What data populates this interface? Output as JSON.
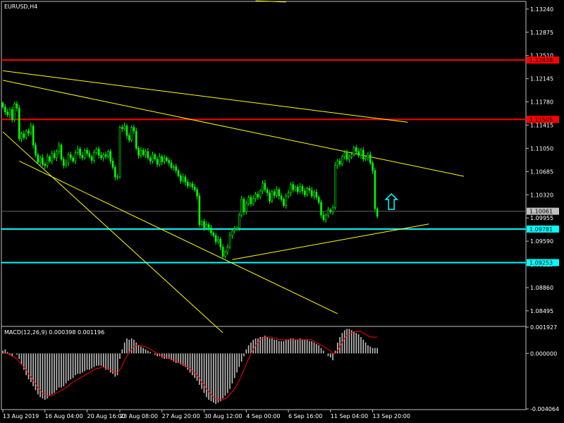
{
  "chart_data": {
    "type": "candlestick",
    "title": "EURUSD,H4",
    "symbol": "EURUSD",
    "timeframe": "H4",
    "background": "#000000",
    "bull_color": "#00ff00",
    "bear_color": "#00ff00",
    "grid": false,
    "price_axis": {
      "ylim": [
        1.0825,
        1.1336
      ],
      "tick_labels": [
        "1.13240",
        "1.12875",
        "1.12510",
        "1.12145",
        "1.11780",
        "1.11415",
        "1.11050",
        "1.10685",
        "1.10320",
        "1.09955",
        "1.09590",
        "1.09225",
        "1.08860",
        "1.08495"
      ],
      "tick_values": [
        1.1324,
        1.12875,
        1.1251,
        1.12145,
        1.1178,
        1.11415,
        1.1105,
        1.10685,
        1.1032,
        1.09955,
        1.0959,
        1.09225,
        1.0886,
        1.08495
      ]
    },
    "time_axis": {
      "labels": [
        "13 Aug 2019",
        "16 Aug 04:00",
        "20 Aug 16:00",
        "23 Aug 08:00",
        "27 Aug 20:00",
        "30 Aug 12:00",
        "4 Sep 00:00",
        "6 Sep 16:00",
        "11 Sep 04:00",
        "13 Sep 20:00"
      ],
      "bar_index": [
        0,
        18,
        36,
        50,
        68,
        86,
        104,
        122,
        140,
        158
      ]
    },
    "current_price": {
      "label": "1.10061",
      "value": 1.10061,
      "color": "#c0c0c0"
    },
    "horizontal_levels": [
      {
        "label": "1.12438",
        "value": 1.12438,
        "color": "#ff0000"
      },
      {
        "label": "1.11505",
        "value": 1.11505,
        "color": "#ff0000"
      },
      {
        "label": "1.09781",
        "value": 1.09781,
        "color": "#00ffff"
      },
      {
        "label": "1.09253",
        "value": 1.09253,
        "color": "#00ffff"
      }
    ],
    "trendlines": [
      {
        "color": "#ffff00",
        "from": {
          "bar": 0,
          "price": 1.1227
        },
        "to": {
          "bar": 173,
          "price": 1.1146
        }
      },
      {
        "color": "#ffff00",
        "from": {
          "bar": 0,
          "price": 1.1212
        },
        "to": {
          "bar": 197,
          "price": 1.1061
        }
      },
      {
        "color": "#ffff00",
        "from": {
          "bar": 0,
          "price": 1.1131
        },
        "to": {
          "bar": 94,
          "price": 1.0815
        }
      },
      {
        "color": "#ffff00",
        "from": {
          "bar": 7,
          "price": 1.1085
        },
        "to": {
          "bar": 143,
          "price": 1.0845
        }
      },
      {
        "color": "#ffff00",
        "from": {
          "bar": 98,
          "price": 1.093
        },
        "to": {
          "bar": 182,
          "price": 1.0986
        }
      },
      {
        "color": "#ffff00",
        "from": {
          "bar": 108,
          "price": 1.1337
        },
        "to": {
          "bar": 121,
          "price": 1.1335
        }
      }
    ],
    "annotation_arrow": {
      "direction": "up",
      "color": "#00ffff",
      "bar": 166,
      "price": 1.103
    },
    "series": [
      {
        "name": "EURUSD",
        "close": [
          1.117,
          1.1162,
          1.1158,
          1.1166,
          1.115,
          1.1175,
          1.1168,
          1.112,
          1.1128,
          1.1122,
          1.1132,
          1.1129,
          1.114,
          1.111,
          1.1095,
          1.1083,
          1.109,
          1.108,
          1.1078,
          1.1092,
          1.1085,
          1.1097,
          1.109,
          1.11,
          1.111,
          1.1088,
          1.1078,
          1.1082,
          1.1095,
          1.109,
          1.1085,
          1.1098,
          1.1104,
          1.1094,
          1.109,
          1.1102,
          1.1097,
          1.1092,
          1.1086,
          1.1098,
          1.1104,
          1.1094,
          1.109,
          1.1095,
          1.1092,
          1.11,
          1.1085,
          1.1075,
          1.106,
          1.106,
          1.1138,
          1.1136,
          1.114,
          1.1125,
          1.1118,
          1.1138,
          1.1132,
          1.1105,
          1.1094,
          1.1102,
          1.1095,
          1.11,
          1.109,
          1.1085,
          1.1095,
          1.1088,
          1.108,
          1.1092,
          1.1084,
          1.109,
          1.1086,
          1.1082,
          1.1075,
          1.1076,
          1.107,
          1.1062,
          1.1054,
          1.106,
          1.1052,
          1.1046,
          1.1049,
          1.1044,
          1.104,
          1.103,
          1.0985,
          1.099,
          1.098,
          1.0985,
          1.098,
          1.0972,
          1.0968,
          1.0958,
          1.0962,
          1.095,
          1.0935,
          1.0942,
          1.095,
          1.0968,
          1.0975,
          1.0978,
          1.098,
          1.1,
          1.1025,
          1.1005,
          1.1018,
          1.1028,
          1.1018,
          1.1026,
          1.1033,
          1.1028,
          1.1038,
          1.105,
          1.104,
          1.1035,
          1.1022,
          1.1037,
          1.1031,
          1.104,
          1.103,
          1.1025,
          1.1015,
          1.103,
          1.1035,
          1.1048,
          1.104,
          1.1044,
          1.1037,
          1.1045,
          1.1038,
          1.1032,
          1.1042,
          1.1039,
          1.103,
          1.1036,
          1.1028,
          1.102,
          1.1,
          1.0993,
          1.1,
          1.1008,
          1.1005,
          1.1012,
          1.1078,
          1.1085,
          1.108,
          1.1092,
          1.1098,
          1.1088,
          1.1092,
          1.1095,
          1.1106,
          1.11,
          1.1094,
          1.1102,
          1.1088,
          1.109,
          1.1095,
          1.1082,
          1.107,
          1.101,
          1.0998
        ]
      }
    ],
    "indicator": {
      "name": "MACD(12,26,9)",
      "label": "MACD(12,26,9) 0.000398 0.001196",
      "macd_value": "0.000398",
      "signal_value": "0.001196",
      "histogram_color": "#c0c0c0",
      "signal_color": "#ff0000",
      "ylim": [
        -0.004064,
        0.001927
      ],
      "tick_labels": [
        "0.001927",
        "0.000000",
        "-0.004064"
      ],
      "tick_values": [
        0.001927,
        0.0,
        -0.004064
      ],
      "histogram": [
        0.0002,
        0.0003,
        0.0001,
        -0.0001,
        -0.0002,
        0.0,
        -0.0001,
        -0.0004,
        -0.0008,
        -0.0012,
        -0.0016,
        -0.0019,
        -0.0021,
        -0.0024,
        -0.0027,
        -0.003,
        -0.0032,
        -0.0033,
        -0.0034,
        -0.0033,
        -0.0031,
        -0.003,
        -0.0029,
        -0.0027,
        -0.0025,
        -0.0025,
        -0.0024,
        -0.0022,
        -0.002,
        -0.0019,
        -0.0018,
        -0.0016,
        -0.0015,
        -0.0015,
        -0.0014,
        -0.0013,
        -0.0012,
        -0.0012,
        -0.0011,
        -0.001,
        -0.0009,
        -0.0009,
        -0.0009,
        -0.001,
        -0.0012,
        -0.0012,
        -0.0014,
        -0.0015,
        -0.0017,
        -0.0016,
        -0.0004,
        0.0003,
        0.0008,
        0.0011,
        0.001,
        0.0011,
        0.001,
        0.0008,
        0.0006,
        0.0005,
        0.0004,
        0.0003,
        0.0002,
        0.0001,
        0.0,
        -0.0001,
        -0.0002,
        -0.0002,
        -0.0003,
        -0.0004,
        -0.0004,
        -0.0004,
        -0.0005,
        -0.0006,
        -0.0007,
        -0.0007,
        -0.0008,
        -0.0009,
        -0.001,
        -0.0012,
        -0.0014,
        -0.0016,
        -0.0018,
        -0.002,
        -0.0023,
        -0.0026,
        -0.0029,
        -0.0032,
        -0.0034,
        -0.0035,
        -0.0036,
        -0.0037,
        -0.0036,
        -0.0035,
        -0.0033,
        -0.0031,
        -0.0029,
        -0.0026,
        -0.0022,
        -0.0018,
        -0.0014,
        -0.001,
        -0.0006,
        -0.0002,
        0.0003,
        0.0006,
        0.0008,
        0.001,
        0.0011,
        0.0011,
        0.0012,
        0.0012,
        0.0013,
        0.0012,
        0.0011,
        0.0011,
        0.001,
        0.001,
        0.0009,
        0.0009,
        0.0009,
        0.001,
        0.001,
        0.0011,
        0.0011,
        0.001,
        0.001,
        0.0011,
        0.001,
        0.001,
        0.001,
        0.0009,
        0.0009,
        0.0008,
        0.0007,
        0.0006,
        0.0004,
        0.0002,
        0.0,
        -0.0002,
        -0.0003,
        -0.0005,
        0.0002,
        0.0008,
        0.0012,
        0.0015,
        0.0017,
        0.0018,
        0.0018,
        0.0017,
        0.0016,
        0.0015,
        0.0014,
        0.0012,
        0.001,
        0.0008,
        0.0006,
        0.0005,
        0.0004,
        0.0004,
        0.0004
      ],
      "signal": [
        0.0,
        0.0,
        0.0,
        -0.0001,
        -0.0002,
        -0.0003,
        -0.0004,
        -0.0006,
        -0.0008,
        -0.001,
        -0.0012,
        -0.0015,
        -0.0017,
        -0.002,
        -0.0022,
        -0.0025,
        -0.0027,
        -0.0029,
        -0.003,
        -0.0031,
        -0.0031,
        -0.0031,
        -0.003,
        -0.0029,
        -0.0028,
        -0.0027,
        -0.0026,
        -0.0025,
        -0.0024,
        -0.0022,
        -0.0021,
        -0.002,
        -0.0019,
        -0.0018,
        -0.0017,
        -0.0016,
        -0.0015,
        -0.0014,
        -0.0013,
        -0.0012,
        -0.0011,
        -0.0011,
        -0.001,
        -0.001,
        -0.0011,
        -0.0011,
        -0.0012,
        -0.0013,
        -0.0014,
        -0.0014,
        -0.0012,
        -0.0009,
        -0.0005,
        -0.0002,
        0.0001,
        0.0003,
        0.0005,
        0.0006,
        0.0006,
        0.0006,
        0.0005,
        0.0005,
        0.0004,
        0.0003,
        0.0002,
        0.0001,
        0.0,
        -0.0001,
        -0.0002,
        -0.0002,
        -0.0003,
        -0.0003,
        -0.0004,
        -0.0005,
        -0.0005,
        -0.0006,
        -0.0007,
        -0.0008,
        -0.0009,
        -0.001,
        -0.0011,
        -0.0013,
        -0.0014,
        -0.0016,
        -0.0018,
        -0.0021,
        -0.0023,
        -0.0026,
        -0.0028,
        -0.003,
        -0.0032,
        -0.0033,
        -0.0034,
        -0.0034,
        -0.0034,
        -0.0033,
        -0.0032,
        -0.003,
        -0.0028,
        -0.0026,
        -0.0023,
        -0.002,
        -0.0016,
        -0.0012,
        -0.0008,
        -0.0004,
        0.0,
        0.0003,
        0.0006,
        0.0008,
        0.001,
        0.0011,
        0.0012,
        0.0012,
        0.0012,
        0.0012,
        0.0011,
        0.0011,
        0.001,
        0.001,
        0.001,
        0.001,
        0.001,
        0.001,
        0.001,
        0.001,
        0.001,
        0.001,
        0.001,
        0.001,
        0.001,
        0.001,
        0.001,
        0.0009,
        0.0008,
        0.0007,
        0.0006,
        0.0005,
        0.0004,
        0.0003,
        0.0002,
        0.0,
        0.0,
        0.0002,
        0.0005,
        0.0008,
        0.0011,
        0.0013,
        0.0014,
        0.0015,
        0.0016,
        0.0016,
        0.0016,
        0.0016,
        0.0015,
        0.0014,
        0.0013,
        0.0012,
        0.0012,
        0.0012,
        0.0012
      ]
    }
  }
}
